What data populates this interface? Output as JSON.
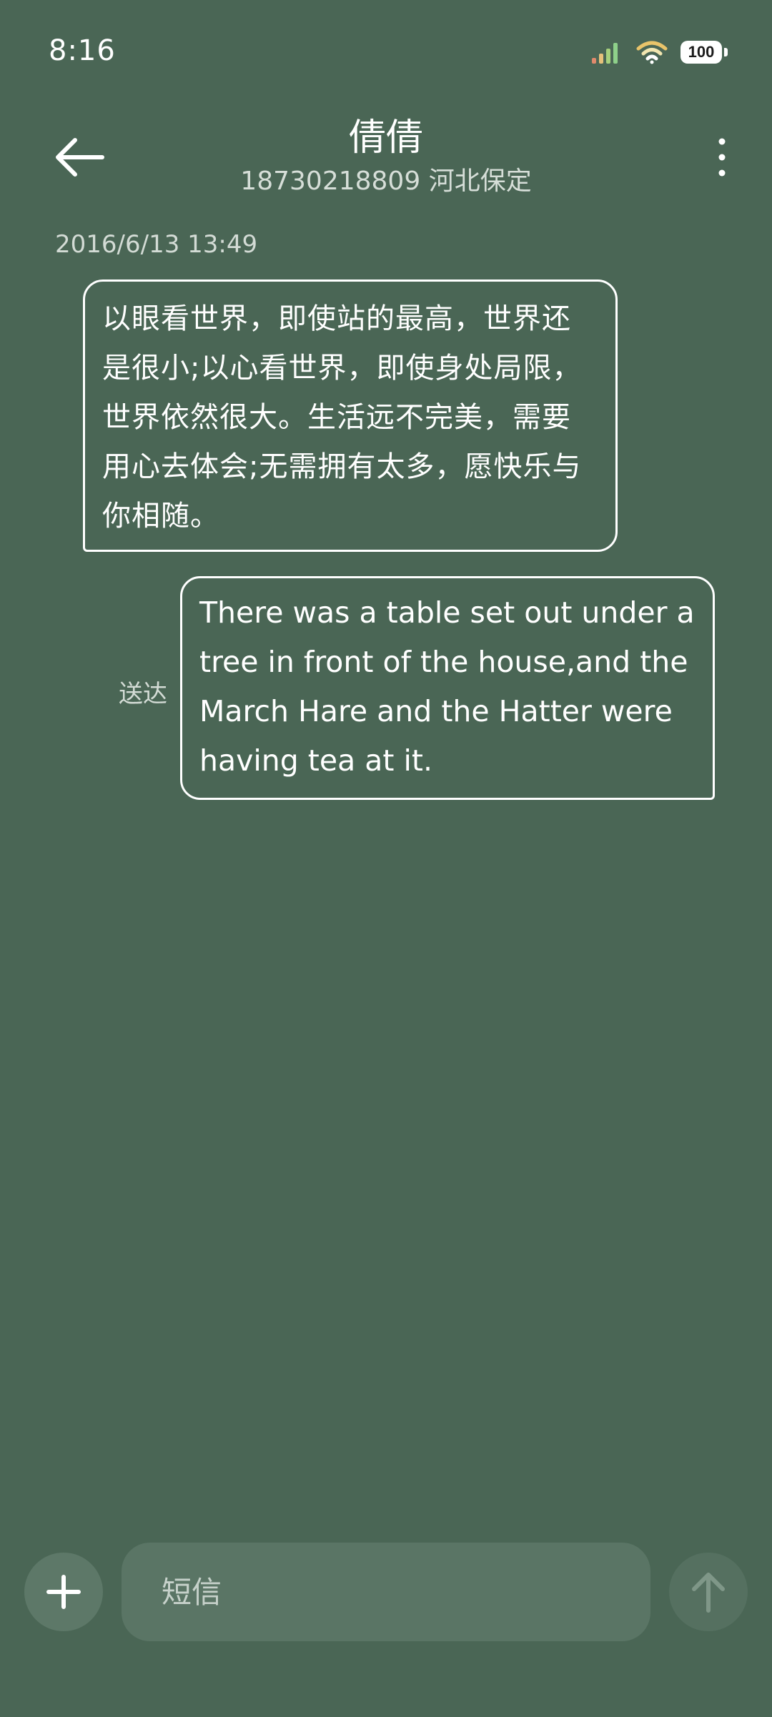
{
  "status_bar": {
    "time": "8:16",
    "battery": "100",
    "signal_icon": "signal-bars-icon",
    "wifi_icon": "wifi-icon"
  },
  "header": {
    "back_icon": "arrow-left-icon",
    "contact_name": "倩倩",
    "contact_detail": "18730218809 河北保定",
    "more_icon": "more-vertical-icon"
  },
  "conversation": {
    "timestamp": "2016/6/13 13:49",
    "messages": [
      {
        "direction": "incoming",
        "text": "以眼看世界，即使站的最高，世界还是很小;以心看世界，即使身处局限，世界依然很大。生活远不完美，需要用心去体会;无需拥有太多，愿快乐与你相随。"
      },
      {
        "direction": "outgoing",
        "text": "There was a table set out under a tree in front of the house,and the March Hare and the Hatter were having tea at it.",
        "status": "送达"
      }
    ]
  },
  "composer": {
    "add_icon": "plus-icon",
    "placeholder": "短信",
    "value": "",
    "send_icon": "arrow-up-icon"
  },
  "colors": {
    "background": "#4a6655",
    "bubble_border": "#ffffff",
    "input_background": "#5a7565"
  }
}
